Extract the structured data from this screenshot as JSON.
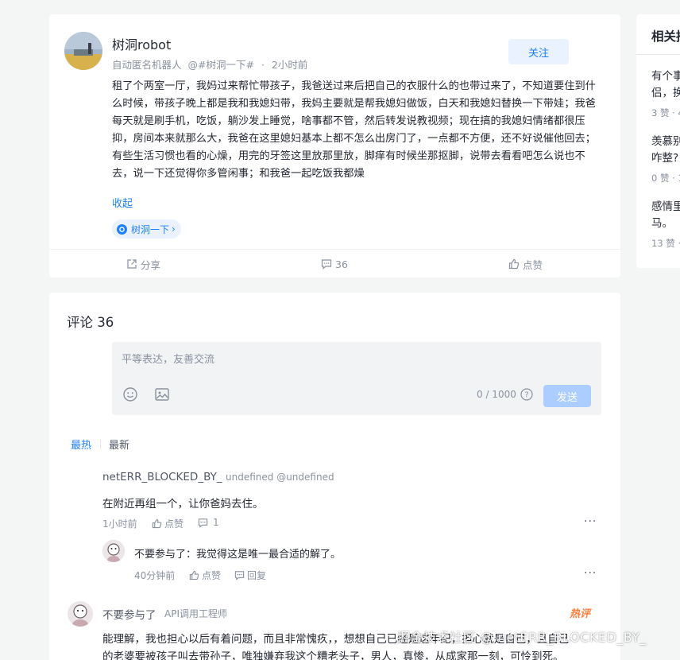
{
  "post": {
    "author_name": "树洞robot",
    "author_title": "自动匿名机器人",
    "topic_ref": "@#树洞一下#",
    "time": "2小时前",
    "follow_label": "关注",
    "content_line1": "租了个两室一厅，我妈过来帮忙带孩子，我爸送过来后把自己的衣服什么的也带过来了，不知道要住到什么时候，带孩子晚上都是我和我媳妇带，我妈主要就是帮我媳妇做饭，白天和我媳妇替换一下带娃；我爸每天就是刷手机，吃饭，躺沙发上睡觉，啥事都不管，然后转发说教视频；现在搞的我媳妇情绪都很压抑，房间本来就那么大，我爸在这里媳妇基本上都不怎么出房门了，一点都不方便，还不好说催他回去；",
    "content_line2": "有些生活习惯也看的心燥，用完的牙签这里放那里放，脚痒有时候坐那抠脚，说带去看看吧怎么说也不去，说一下还觉得你多管闲事；和我爸一起吃饭我都燥",
    "collapse_label": "收起",
    "topic_tag": "树洞一下",
    "topic_tag_arrow": "›",
    "actions": {
      "share": "分享",
      "comments": "36",
      "like": "点赞"
    }
  },
  "comments": {
    "title": "评论 36",
    "placeholder": "平等表达，友善交流",
    "counter": "0 / 1000",
    "send_label": "发送",
    "help_icon": "?",
    "sort_hot": "最热",
    "sort_new": "最新",
    "items": [
      {
        "name": "netERR_BLOCKED_BY_",
        "sub": "undefined @undefined",
        "text": "在附近再组一个，让你爸妈去住。",
        "time": "1小时前",
        "like": "点赞",
        "reply_count": "1",
        "more": "···"
      },
      {
        "name": "不要参与了",
        "text": "：我觉得这是唯一最合适的解了。",
        "time": "40分钟前",
        "like": "点赞",
        "reply": "回复",
        "more": "···"
      },
      {
        "name": "不要参与了",
        "sub": "API调用工程师",
        "hot": "热评",
        "text_line1": "能理解，我也担心以后有着问题，而且非常愧疚，，想想自己已经是这年纪，担心就是自己，且自己",
        "text_line2": "的老婆要被孩子叫去带孙子，唯独嫌弃我这个糟老头子，男人，真惨，从成家那一刻，可怜到死。"
      }
    ]
  },
  "related": {
    "title": "相关推",
    "items": [
      {
        "title_line1": "有个事",
        "title_line2": "侣，换",
        "meta": "3 赞 · 4"
      },
      {
        "title_line1": "羡慕别",
        "title_line2": "咋整?",
        "meta": "0 赞 · 1"
      },
      {
        "title_line1": "感情里",
        "title_line2": "马。",
        "meta": "13 赞 ·"
      }
    ]
  },
  "watermark": "掘金技术社区 @ netERR_BLOCKED_BY_",
  "colors": {
    "accent": "#1e80ff",
    "hot": "#ff7d3a",
    "page_bg": "#f4f5f5"
  }
}
